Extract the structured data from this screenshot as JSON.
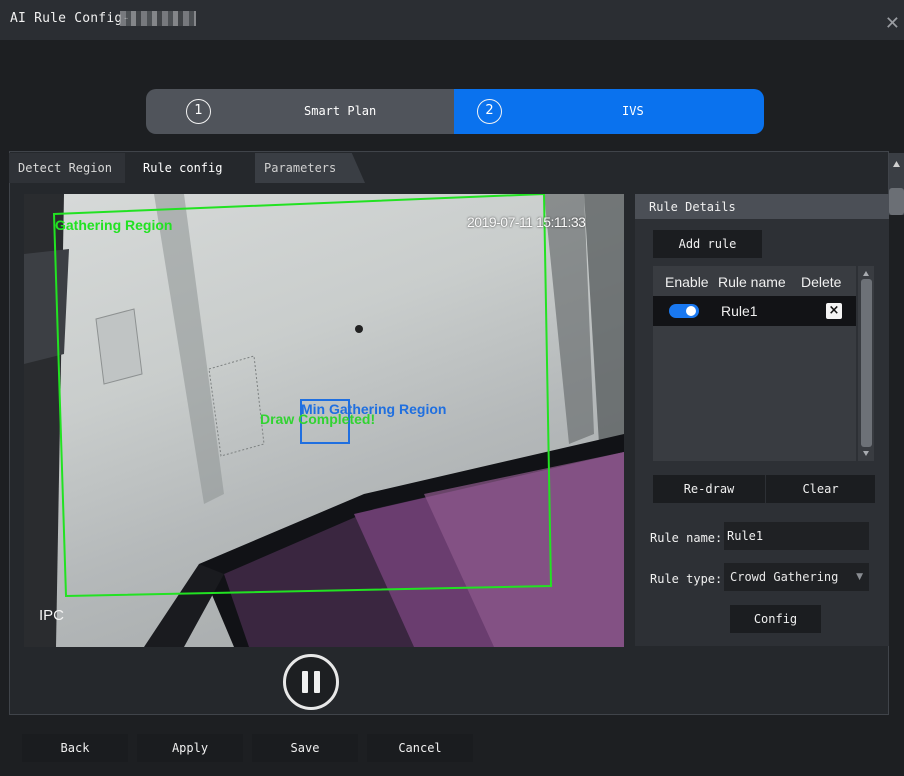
{
  "window": {
    "title": "AI Rule Config-",
    "close_icon": "close-icon"
  },
  "stepper": {
    "steps": [
      {
        "number": "1",
        "label": "Smart Plan",
        "active": false
      },
      {
        "number": "2",
        "label": "IVS",
        "active": true
      }
    ],
    "active_color": "#0a72ee"
  },
  "tabs": [
    {
      "label": "Detect Region"
    },
    {
      "label": "Rule config",
      "active": true
    },
    {
      "label": "Parameters"
    }
  ],
  "video": {
    "timestamp": "2019-07-11 15:11:33",
    "camera_label": "IPC",
    "overlays": {
      "gathering_region": "Gathering Region",
      "min_gathering_region": "Min Gathering Region",
      "draw_status": "Draw Completed!"
    },
    "region_color": "#22e222",
    "min_region_color": "#1f6fe0",
    "playback_icon": "pause-icon"
  },
  "rule_details": {
    "title": "Rule Details",
    "add_rule_label": "Add rule",
    "table": {
      "columns": [
        "Enable",
        "Rule name",
        "Delete"
      ],
      "rows": [
        {
          "enabled": true,
          "name": "Rule1",
          "delete_icon": "close-square-icon"
        }
      ]
    },
    "redraw_label": "Re-draw",
    "clear_label": "Clear",
    "rule_name_label": "Rule name:",
    "rule_name_value": "Rule1",
    "rule_type_label": "Rule type:",
    "rule_type_value": "Crowd Gathering",
    "config_label": "Config"
  },
  "footer": {
    "back_label": "Back",
    "apply_label": "Apply",
    "save_label": "Save",
    "cancel_label": "Cancel"
  }
}
